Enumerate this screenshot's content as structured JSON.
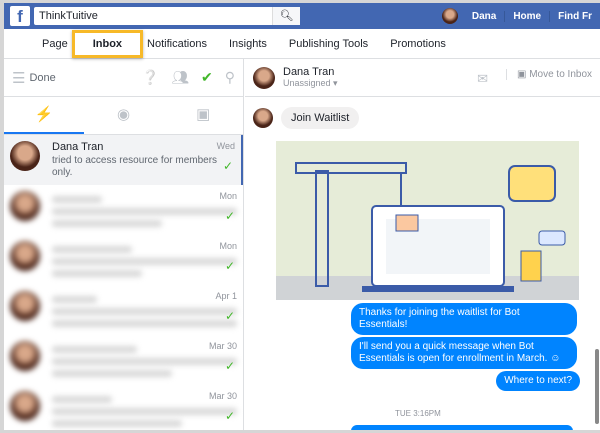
{
  "header": {
    "logo": "f",
    "search_value": "ThinkTuitive",
    "user": "Dana",
    "links": [
      "Home",
      "Find Fr"
    ]
  },
  "nav": {
    "tabs": [
      "Page",
      "Inbox",
      "Notifications",
      "Insights",
      "Publishing Tools",
      "Promotions"
    ]
  },
  "inbox": {
    "filter": "Done",
    "conversations": [
      {
        "name": "Dana Tran",
        "preview": "tried to access resource for members only.",
        "date": "Wed"
      },
      {
        "date": "Mon"
      },
      {
        "date": "Mon"
      },
      {
        "date": "Apr 1"
      },
      {
        "date": "Mar 30"
      },
      {
        "date": "Mar 30"
      }
    ]
  },
  "thread": {
    "name": "Dana Tran",
    "assignee": "Unassigned",
    "move_label": "Move to Inbox",
    "quick_reply": "Join Waitlist",
    "messages": [
      "Thanks for joining the waitlist for Bot Essentials!",
      "I'll send you a quick message when Bot Essentials is open for enrollment in March. ☺",
      "Where to next?"
    ],
    "timestamp": "TUE 3:16PM"
  }
}
